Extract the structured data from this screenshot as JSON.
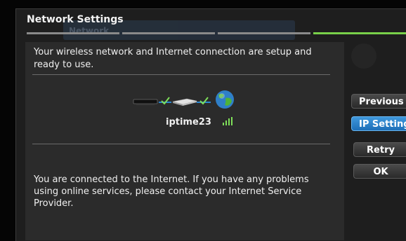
{
  "window": {
    "title": "Network Settings",
    "ghost_title": "Network"
  },
  "steps": {
    "total": 4,
    "active_index": 3
  },
  "status": {
    "message": "Your wireless network and Internet connection are setup and ready to use."
  },
  "connection": {
    "network_name": "iptime23",
    "icons": [
      "tv-device-icon",
      "check-icon",
      "router-icon",
      "check-icon",
      "globe-icon"
    ],
    "signal_icon": "signal-strength-icon"
  },
  "info": {
    "message": "You are connected to the Internet. If you have any problems using online services, please contact your Internet Service Provider."
  },
  "buttons": {
    "previous": "Previous",
    "ip_settings": "IP Settings",
    "retry": "Retry",
    "ok": "OK"
  },
  "colors": {
    "accent": "#2a86d0",
    "progress_active": "#79d04a",
    "check": "#7fe05a"
  }
}
